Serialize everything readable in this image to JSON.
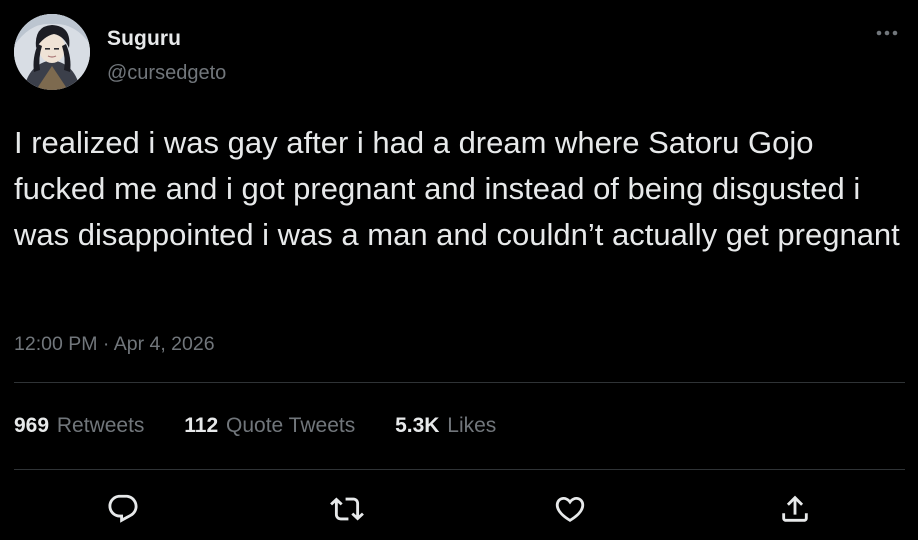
{
  "author": {
    "display_name": "Suguru",
    "handle": "@cursedgeto",
    "avatar_icon": "anime-character-avatar"
  },
  "tweet": {
    "text": "I realized i was gay after i had a dream where Satoru Gojo fucked me and i got pregnant and instead of being disgusted i was disappointed i was a man and couldn’t actually get pregnant",
    "time": "12:00 PM",
    "separator": "·",
    "date": "Apr 4, 2026"
  },
  "stats": {
    "retweets_count": "969",
    "retweets_label": "Retweets",
    "quotes_count": "112",
    "quotes_label": "Quote Tweets",
    "likes_count": "5.3K",
    "likes_label": "Likes"
  },
  "actions": [
    "reply-icon",
    "retweet-icon",
    "like-icon",
    "share-icon"
  ],
  "colors": {
    "background": "#000000",
    "primary_text": "#e7e9ea",
    "secondary_text": "#71767b",
    "divider": "#2f3336"
  }
}
